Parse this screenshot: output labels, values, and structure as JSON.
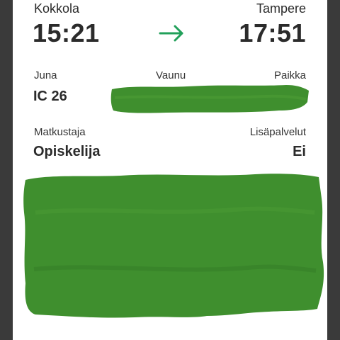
{
  "journey": {
    "origin": "Kokkola",
    "destination": "Tampere",
    "departure_time": "15:21",
    "arrival_time": "17:51"
  },
  "train": {
    "train_label": "Juna",
    "train_value": "IC 26",
    "carriage_label": "Vaunu",
    "seat_label": "Paikka"
  },
  "passenger": {
    "passenger_label": "Matkustaja",
    "passenger_value": "Opiskelija",
    "extras_label": "Lisäpalvelut",
    "extras_value": "Ei"
  },
  "colors": {
    "arrow": "#22a05a",
    "redaction": "#3f8f2e"
  },
  "icons": {
    "arrow": "arrow-right-icon"
  }
}
